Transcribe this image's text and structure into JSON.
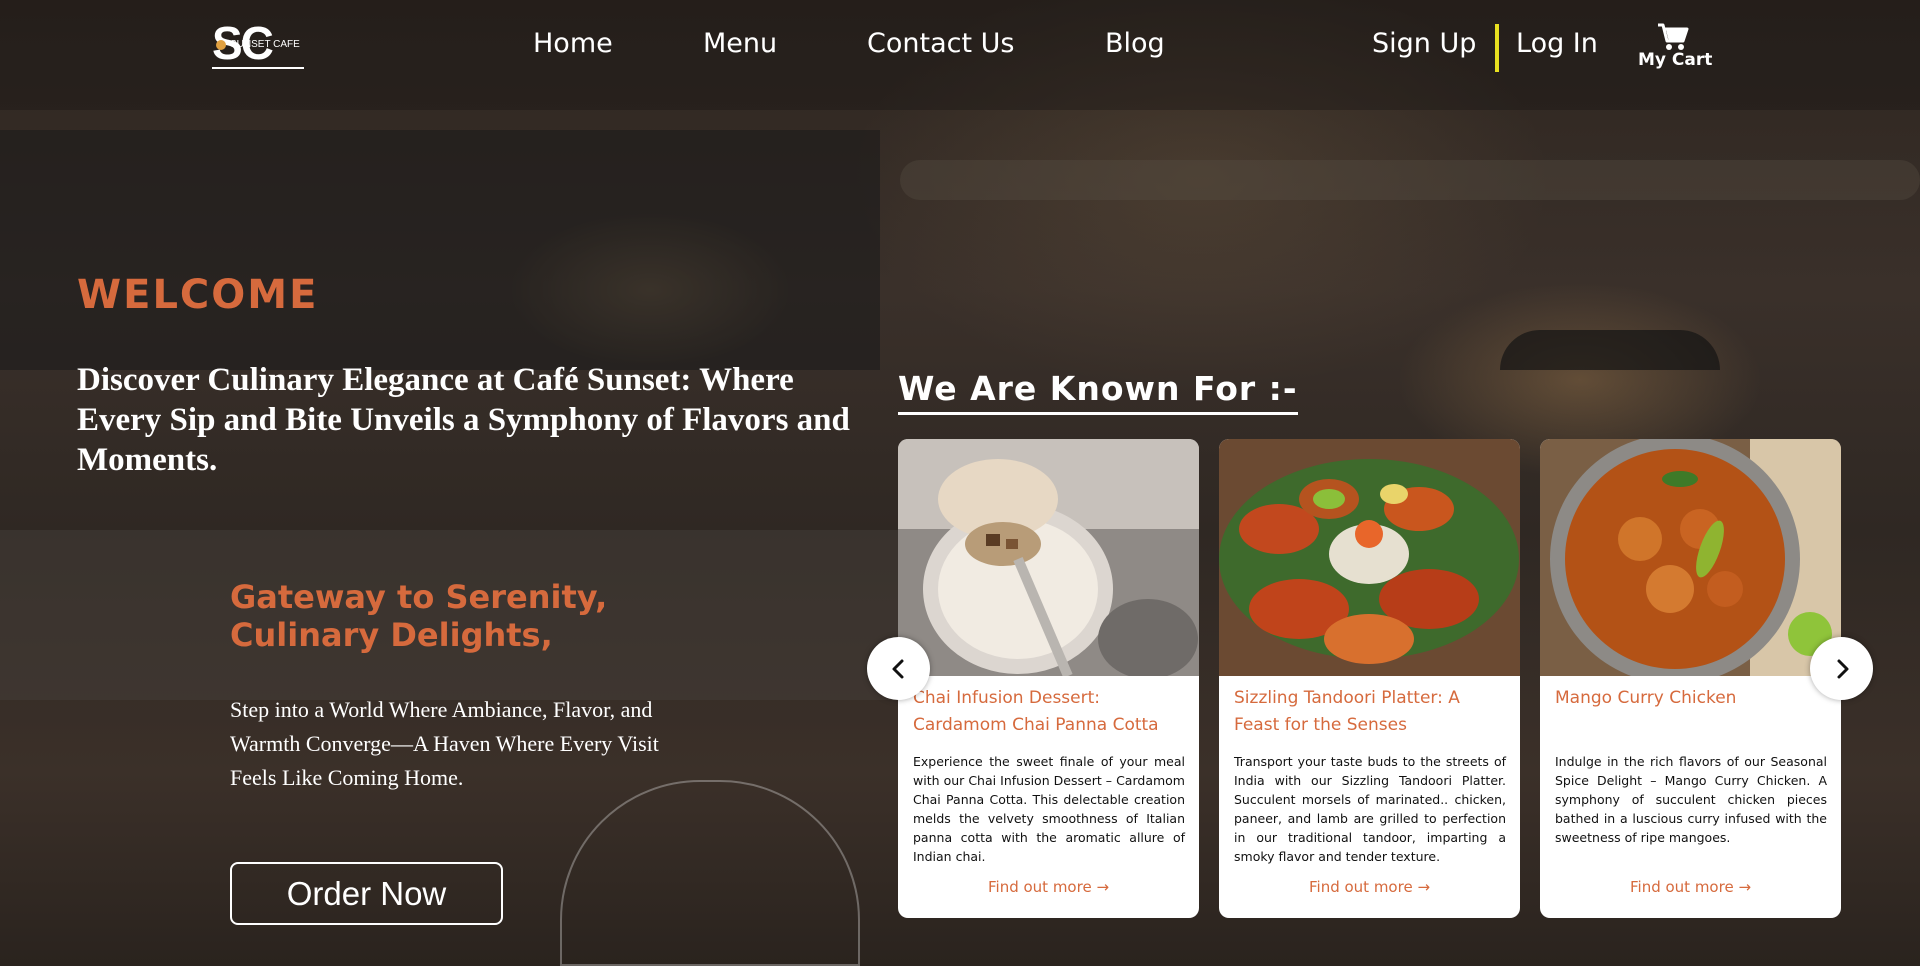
{
  "brand": {
    "logo_letters": "SC",
    "logo_name": "SUNSET CAFE"
  },
  "nav": {
    "home": "Home",
    "menu": "Menu",
    "contact": "Contact Us",
    "blog": "Blog",
    "sign_up": "Sign Up",
    "log_in": "Log In",
    "cart_label": "My Cart",
    "cart_icon": "cart-icon",
    "separator_color": "#e8e020"
  },
  "hero": {
    "welcome": "WELCOME",
    "title": "Discover Culinary Elegance at Café Sunset: Where Every Sip and Bite Unveils a Symphony of Flavors and Moments.",
    "tagline_line1": "Gateway to Serenity,",
    "tagline_line2": "Culinary Delights,",
    "description": "Step into a World Where Ambiance, Flavor, and Warmth Converge—A Haven Where Every Visit Feels Like Coming Home.",
    "order_button": "Order Now",
    "accent_color": "#d66a3d"
  },
  "known_for": {
    "heading": "We Are Known For :-",
    "prev_icon": "chevron-left-icon",
    "next_icon": "chevron-right-icon",
    "cards": [
      {
        "title": "Chai Infusion Dessert: Cardamom Chai Panna Cotta",
        "text": "Experience the sweet finale of your meal with our Chai Infusion Dessert – Cardamom Chai Panna Cotta. This delectable creation melds the velvety smoothness of Italian panna cotta with the aromatic allure of Indian chai.",
        "link": "Find out more →"
      },
      {
        "title": "Sizzling Tandoori Platter: A Feast for the Senses",
        "text": "Transport your taste buds to the streets of India with our Sizzling Tandoori Platter. Succulent morsels of marinated.. chicken, paneer, and lamb are grilled to perfection in our traditional tandoor, imparting a smoky flavor and tender texture.",
        "link": "Find out more →"
      },
      {
        "title": "Mango Curry Chicken",
        "text": "Indulge in the rich flavors of our Seasonal Spice Delight – Mango Curry Chicken. A symphony of succulent chicken pieces bathed in a luscious curry infused with the sweetness of ripe mangoes.",
        "link": "Find out more →"
      }
    ]
  }
}
